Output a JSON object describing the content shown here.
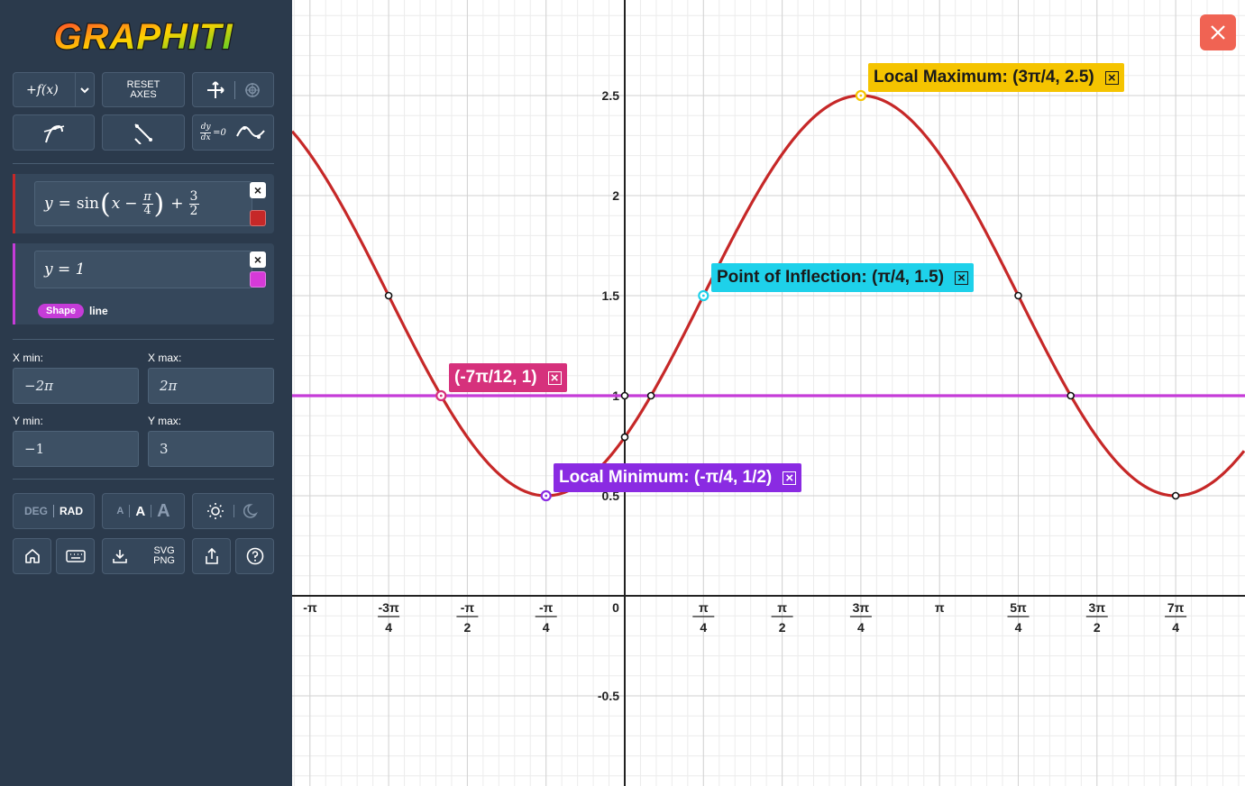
{
  "app": {
    "logo_text": "GRAPHITI"
  },
  "toolbar": {
    "add_function_label": "+f(x)",
    "reset_axes_label_1": "RESET",
    "reset_axes_label_2": "AXES",
    "dydx_label_num": "dy",
    "dydx_label_den": "dx",
    "dydx_eq": "=0"
  },
  "expressions": [
    {
      "latex_display": "y = sin(x − π/4) + 3/2",
      "color": "#c62828",
      "parts": {
        "y": "y",
        "eq": "=",
        "sin": "sin",
        "x": "x",
        "minus": "−",
        "pi": "π",
        "four": "4",
        "plus": "+",
        "three": "3",
        "two": "2"
      }
    },
    {
      "latex_display": "y = 1",
      "color": "#d63ad8",
      "shape_badge": "Shape",
      "shape_value": "line"
    }
  ],
  "range": {
    "xmin_label": "X min:",
    "xmin_value": "−2π",
    "xmax_label": "X max:",
    "xmax_value": "2π",
    "ymin_label": "Y min:",
    "ymin_value": "−1",
    "ymax_label": "Y max:",
    "ymax_value": "3"
  },
  "settings": {
    "deg_label": "DEG",
    "rad_label": "RAD",
    "font_small": "A",
    "font_medium": "A",
    "font_large": "A",
    "svg_label": "SVG",
    "png_label": "PNG"
  },
  "annotations": {
    "local_max": {
      "text": "Local Maximum: (3π/4, 2.5)",
      "color": "#f5c400"
    },
    "inflection": {
      "text": "Point of Inflection: (π/4, 1.5)",
      "color": "#1ed1ea"
    },
    "intersection": {
      "text": "(-7π/12, 1)",
      "color": "#d6317c"
    },
    "local_min": {
      "text": "Local Minimum: (-π/4, 1/2)",
      "color": "#8a2be2"
    },
    "close_glyph": "×"
  },
  "chart_data": {
    "type": "line",
    "series": [
      {
        "expr": "y = sin(x - π/4) + 3/2",
        "color": "#c62828"
      },
      {
        "expr": "y = 1",
        "color": "#c53cd8"
      }
    ],
    "x_tick_labels": [
      {
        "num": "-π",
        "den": ""
      },
      {
        "num": "-3π",
        "den": "4"
      },
      {
        "num": "-π",
        "den": "2"
      },
      {
        "num": "-π",
        "den": "4"
      },
      {
        "num": "0",
        "den": ""
      },
      {
        "num": "π",
        "den": "4"
      },
      {
        "num": "π",
        "den": "2"
      },
      {
        "num": "3π",
        "den": "4"
      },
      {
        "num": "π",
        "den": ""
      },
      {
        "num": "5π",
        "den": "4"
      },
      {
        "num": "3π",
        "den": "2"
      },
      {
        "num": "7π",
        "den": "4"
      }
    ],
    "y_tick_labels": [
      "2.5",
      "2",
      "1.5",
      "1",
      "0.5",
      "-0.5"
    ],
    "visible_x_range": [
      "-π",
      "7π/4"
    ],
    "visible_y_range": [
      -1,
      2.9
    ],
    "grid": true
  }
}
